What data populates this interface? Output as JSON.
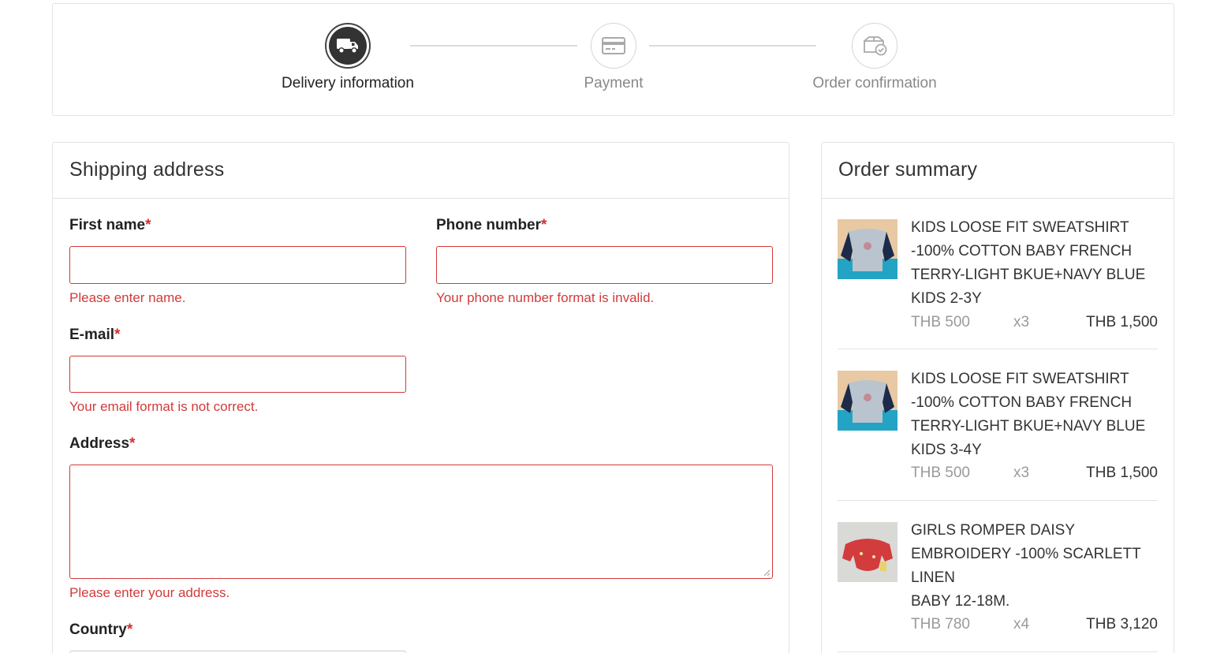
{
  "stepper": {
    "steps": [
      {
        "label": "Delivery information",
        "icon": "truck-icon",
        "active": true
      },
      {
        "label": "Payment",
        "icon": "credit-card-icon",
        "active": false
      },
      {
        "label": "Order confirmation",
        "icon": "box-check-icon",
        "active": false
      }
    ]
  },
  "shipping": {
    "title": "Shipping address",
    "required_mark": "*",
    "fields": {
      "first_name": {
        "label": "First name",
        "value": "",
        "error": "Please enter name."
      },
      "phone": {
        "label": "Phone number",
        "value": "",
        "error": "Your phone number format is invalid."
      },
      "email": {
        "label": "E-mail",
        "value": "",
        "error": "Your email format is not correct."
      },
      "address": {
        "label": "Address",
        "value": "",
        "error": "Please enter your address."
      },
      "country": {
        "label": "Country"
      }
    },
    "error_color": "#d23a3a"
  },
  "order": {
    "title": "Order summary",
    "items": [
      {
        "name": "KIDS LOOSE FIT SWEATSHIRT -100% COTTON BABY FRENCH TERRY-LIGHT BKUE+NAVY BLUE",
        "variant": "KIDS 2-3Y",
        "unit_price": "THB 500",
        "qty": "x3",
        "total": "THB 1,500",
        "thumb": "sweatshirt-thumbnail"
      },
      {
        "name": "KIDS LOOSE FIT SWEATSHIRT -100% COTTON BABY FRENCH TERRY-LIGHT BKUE+NAVY BLUE",
        "variant": "KIDS 3-4Y",
        "unit_price": "THB 500",
        "qty": "x3",
        "total": "THB 1,500",
        "thumb": "sweatshirt-thumbnail"
      },
      {
        "name": "GIRLS ROMPER DAISY EMBROIDERY -100% SCARLETT LINEN",
        "variant": "BABY 12-18M.",
        "unit_price": "THB 780",
        "qty": "x4",
        "total": "THB 3,120",
        "thumb": "romper-thumbnail"
      }
    ]
  }
}
